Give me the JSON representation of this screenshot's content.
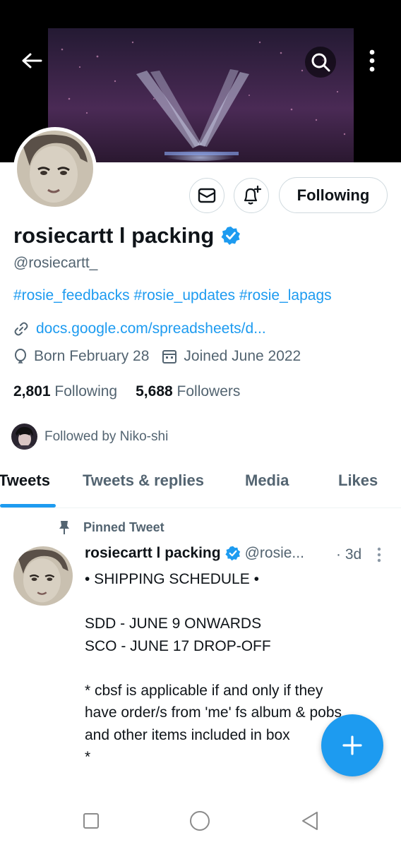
{
  "profile": {
    "display_name": "rosiecartt l packing",
    "handle": "@rosiecartt_",
    "bio": "#rosie_feedbacks #rosie_updates #rosie_lapags",
    "link": "docs.google.com/spreadsheets/d...",
    "birthday": "Born February 28",
    "joined": "Joined June 2022",
    "following_count": "2,801",
    "following_label": "Following",
    "followers_count": "5,688",
    "followers_label": "Followers",
    "followed_by": "Followed by Niko-shi",
    "following_button_label": "Following"
  },
  "tabs": [
    {
      "label": "Tweets",
      "active": true
    },
    {
      "label": "Tweets & replies",
      "active": false
    },
    {
      "label": "Media",
      "active": false
    },
    {
      "label": "Likes",
      "active": false
    }
  ],
  "tweet": {
    "pinned_label": "Pinned Tweet",
    "author_name": "rosiecartt l packing",
    "author_handle": "@rosie...",
    "time": "· 3d",
    "lines": [
      "• SHIPPING SCHEDULE •",
      "",
      "SDD - JUNE 9 ONWARDS",
      "SCO - JUNE 17 DROP-OFF",
      "",
      "* cbsf is applicable if and only if they",
      "have order/s from 'me' fs album & pobs",
      "and other items included in box",
      "*"
    ]
  },
  "icons": {
    "back": "arrow-left-icon",
    "search": "search-icon",
    "more": "more-vertical-icon",
    "mail": "mail-icon",
    "notify": "bell-plus-icon",
    "verified": "verified-badge-icon",
    "link": "link-icon",
    "birthday": "balloon-icon",
    "calendar": "calendar-icon",
    "pin": "pin-icon",
    "compose": "plus-icon"
  },
  "colors": {
    "accent": "#1d9bf0",
    "text": "#0f1419",
    "secondary": "#536471",
    "border": "#cfd9de"
  }
}
